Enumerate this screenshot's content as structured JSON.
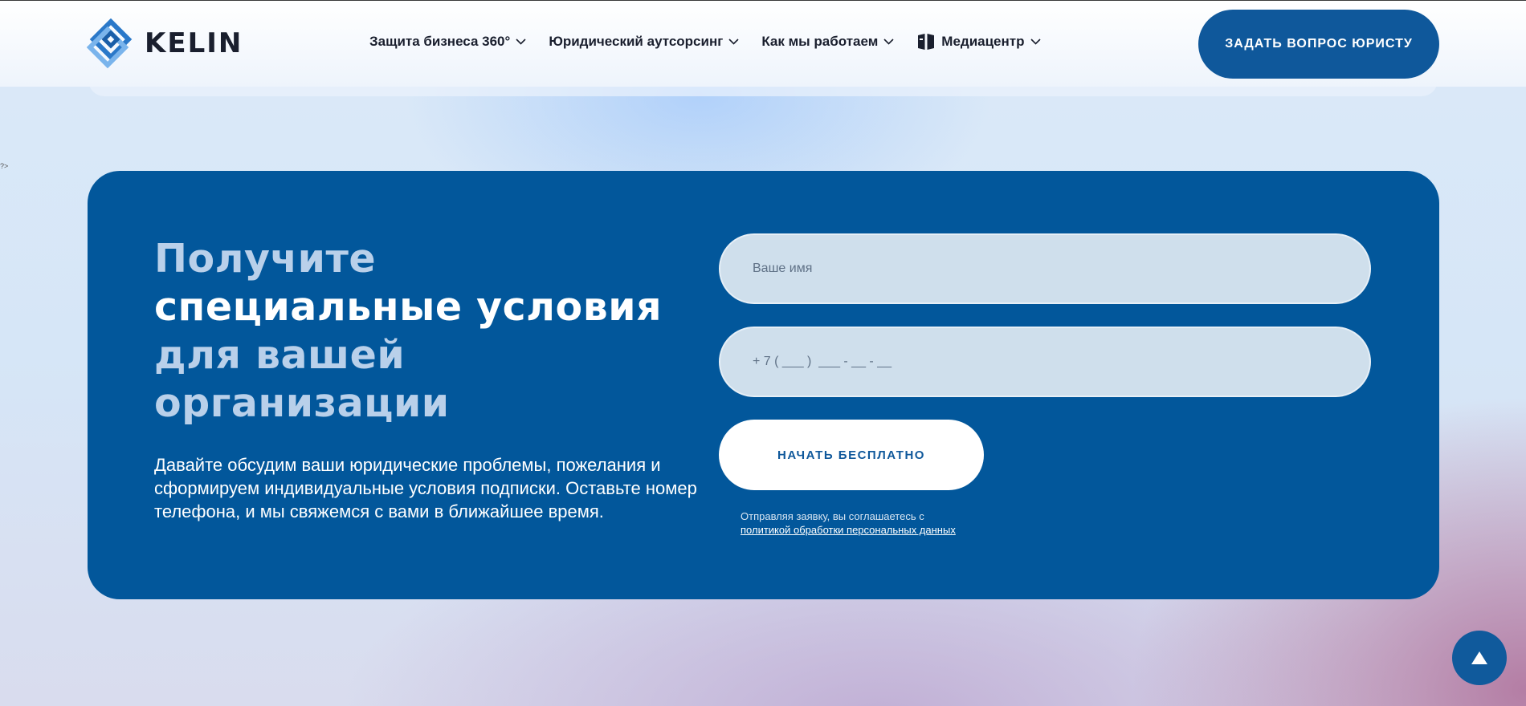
{
  "brand": {
    "name": "KELIN"
  },
  "nav": {
    "items": [
      {
        "label": "Защита бизнеса 360°",
        "icon": "chevron-down-icon"
      },
      {
        "label": "Юридический аутсорсинг",
        "icon": "chevron-down-icon"
      },
      {
        "label": "Как мы работаем",
        "icon": "chevron-down-icon"
      },
      {
        "label": "Медиацентр",
        "icon": "book-icon"
      }
    ]
  },
  "header": {
    "ask_button_label": "ЗАДАТЬ ВОПРОС ЮРИСТУ"
  },
  "stray_text": "?>",
  "offer": {
    "headline": {
      "line1": "Получите",
      "line2": "специальные условия",
      "line3": "для вашей",
      "line4": "организации"
    },
    "description": "Давайте обсудим ваши юридические проблемы, пожелания и сформируем индивидуальные условия подписки. Оставьте номер телефона, и мы свяжемся с вами в ближайшее время."
  },
  "form": {
    "name_placeholder": "Ваше имя",
    "phone_placeholder": "+ 7 ( ___ )  ___ - __ - __",
    "submit_label": "НАЧАТЬ БЕСПЛАТНО",
    "consent_text": "Отправляя заявку, вы соглашаетесь с",
    "consent_link": "политикой обработки персональных данных"
  },
  "colors": {
    "primary": "#02579b",
    "button_dark": "#0f589b",
    "headline_light": "#b9d0ea",
    "input_bg": "#cfdfec"
  }
}
